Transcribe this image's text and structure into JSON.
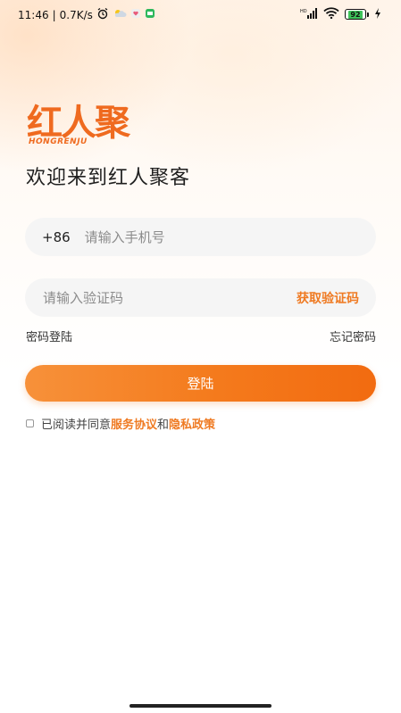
{
  "status_bar": {
    "time": "11:46",
    "separator": "|",
    "net_speed": "0.7K/s",
    "battery_level": "92",
    "signal_label": "HD"
  },
  "logo": {
    "chinese": "红人聚",
    "english": "HONGRENJU",
    "brand_color": "#ef6a1f"
  },
  "welcome_text": "欢迎来到红人聚客",
  "phone": {
    "prefix": "+86",
    "placeholder": "请输入手机号"
  },
  "code": {
    "placeholder": "请输入验证码",
    "get_code_label": "获取验证码"
  },
  "links": {
    "password_login": "密码登陆",
    "forgot_password": "忘记密码"
  },
  "login_button": "登陆",
  "agreement": {
    "prefix": "已阅读并同意",
    "service": "服务协议",
    "and": "和",
    "privacy": "隐私政策",
    "checked": false
  },
  "colors": {
    "accent": "#f47a1c",
    "field_bg": "#f5f5f5"
  }
}
